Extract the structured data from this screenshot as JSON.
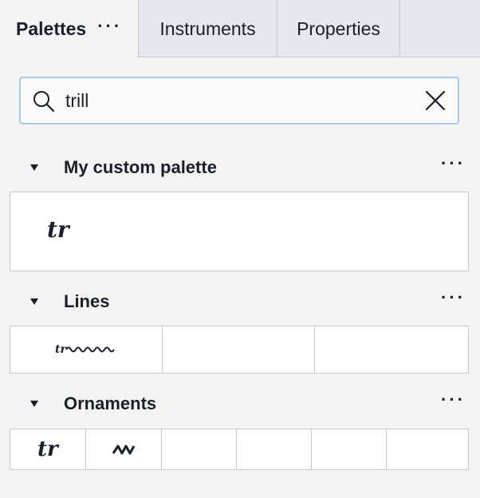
{
  "tabs": [
    {
      "label": "Palettes",
      "active": true
    },
    {
      "label": "Instruments",
      "active": false
    },
    {
      "label": "Properties",
      "active": false
    }
  ],
  "tab_menu_label": "···",
  "search": {
    "value": "trill",
    "icon": "search-icon",
    "clear_icon": "close-icon"
  },
  "sections": [
    {
      "title": "My custom palette",
      "menu_label": "···",
      "cells": [
        "tr"
      ]
    },
    {
      "title": "Lines",
      "menu_label": "···",
      "cells": [
        "trill-line",
        "",
        ""
      ]
    },
    {
      "title": "Ornaments",
      "menu_label": "···",
      "cells": [
        "tr",
        "mordent",
        "",
        "",
        "",
        ""
      ]
    }
  ],
  "symbols": {
    "trill_text": "tr"
  },
  "colors": {
    "tab_bar": "#e5e8ee",
    "panel_bg": "#f4f4f4",
    "search_border": "#a9c9ec",
    "text": "#1a1f2b",
    "cell_border": "#c6cbd3"
  }
}
